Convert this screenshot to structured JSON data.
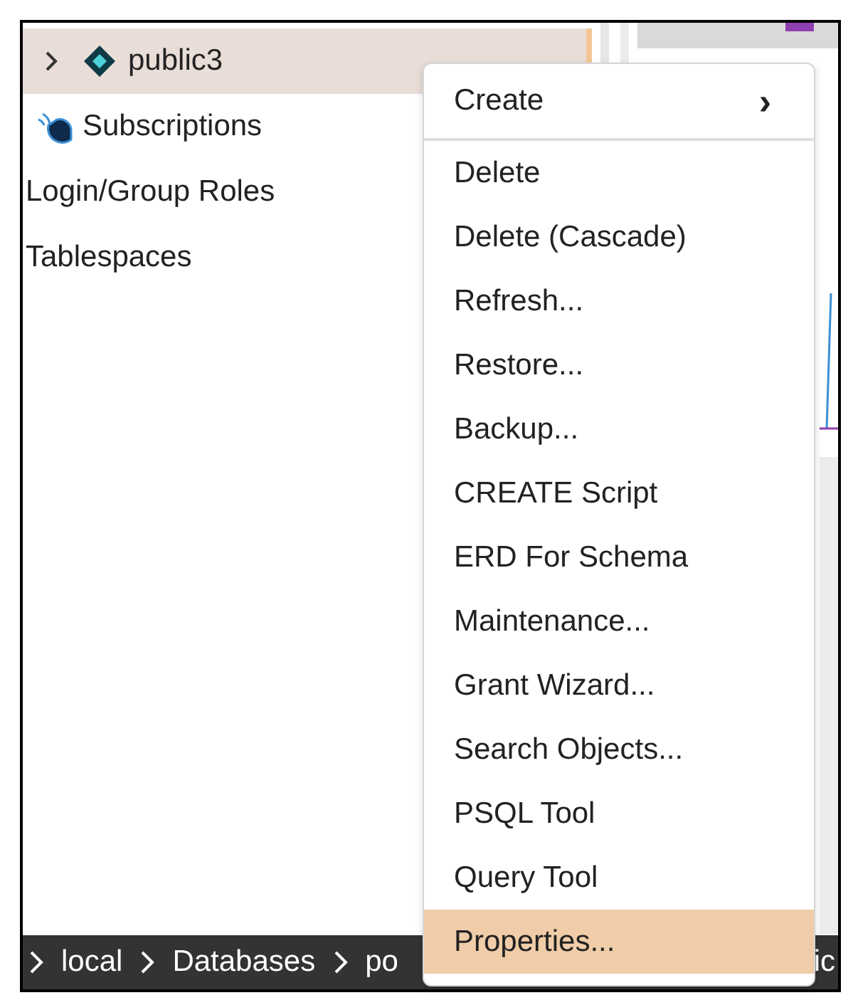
{
  "tree": [
    {
      "kind": "schema",
      "label": "public3",
      "selected": true,
      "expanded": false
    },
    {
      "kind": "subscriptions",
      "label": "Subscriptions",
      "selected": false
    },
    {
      "kind": "plain",
      "label": "Login/Group Roles",
      "selected": false
    },
    {
      "kind": "plain",
      "label": "Tablespaces",
      "selected": false
    }
  ],
  "context_menu": {
    "items": [
      {
        "label": "Create",
        "arrow": "›",
        "selected": false
      },
      {
        "label": "Delete",
        "selected": false
      },
      {
        "label": "Delete (Cascade)",
        "selected": false
      },
      {
        "label": "Refresh...",
        "selected": false
      },
      {
        "label": "Restore...",
        "selected": false
      },
      {
        "label": "Backup...",
        "selected": false
      },
      {
        "label": "CREATE Script",
        "selected": false
      },
      {
        "label": "ERD For Schema",
        "selected": false
      },
      {
        "label": "Maintenance...",
        "selected": false
      },
      {
        "label": "Grant Wizard...",
        "selected": false
      },
      {
        "label": "Search Objects...",
        "selected": false
      },
      {
        "label": "PSQL Tool",
        "selected": false
      },
      {
        "label": "Query Tool",
        "selected": false
      },
      {
        "label": "Properties...",
        "selected": true
      }
    ]
  },
  "breadcrumb": [
    {
      "label": "local"
    },
    {
      "label": "Databases"
    },
    {
      "label": "po"
    }
  ],
  "breadcrumb_tail": "ic"
}
